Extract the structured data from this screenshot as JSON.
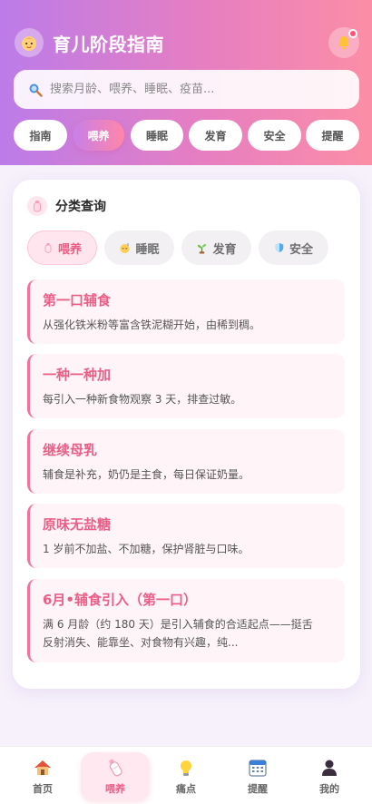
{
  "header": {
    "title": "育儿阶段指南",
    "avatar_icon": "baby-face-icon",
    "bell_icon": "bell-icon"
  },
  "search": {
    "placeholder": "搜索月龄、喂养、睡眠、疫苗..."
  },
  "tabs": [
    {
      "label": "指南",
      "active": false
    },
    {
      "label": "喂养",
      "active": true
    },
    {
      "label": "睡眠",
      "active": false
    },
    {
      "label": "发育",
      "active": false
    },
    {
      "label": "安全",
      "active": false
    },
    {
      "label": "提醒",
      "active": false
    }
  ],
  "category": {
    "title": "分类查询",
    "chips": [
      {
        "label": "喂养",
        "icon": "bottle-icon",
        "active": true
      },
      {
        "label": "睡眠",
        "icon": "sleep-face-icon",
        "active": false
      },
      {
        "label": "发育",
        "icon": "sprout-icon",
        "active": false
      },
      {
        "label": "安全",
        "icon": "shield-icon",
        "active": false
      }
    ]
  },
  "items": [
    {
      "title": "第一口辅食",
      "desc": "从强化铁米粉等富含铁泥糊开始，由稀到稠。"
    },
    {
      "title": "一种一种加",
      "desc": "每引入一种新食物观察 3 天，排查过敏。"
    },
    {
      "title": "继续母乳",
      "desc": "辅食是补充，奶仍是主食，每日保证奶量。"
    },
    {
      "title": "原味无盐糖",
      "desc": "1 岁前不加盐、不加糖，保护肾脏与口味。"
    },
    {
      "title": "6月•辅食引入（第一口）",
      "desc_line1": "满 6 月龄（约 180 天）是引入辅食的合适起点——挺舌",
      "desc_line2": "反射消失、能靠坐、对食物有兴趣，纯..."
    }
  ],
  "bottom_nav": [
    {
      "label": "首页",
      "icon": "house-icon",
      "active": false
    },
    {
      "label": "喂养",
      "icon": "bottle-icon",
      "active": true
    },
    {
      "label": "痛点",
      "icon": "lightbulb-icon",
      "active": false
    },
    {
      "label": "提醒",
      "icon": "calendar-icon",
      "active": false
    },
    {
      "label": "我的",
      "icon": "person-icon",
      "active": false
    }
  ],
  "colors": {
    "accent": "#ef5b87",
    "header_start": "#bb7ce9",
    "header_end": "#fb8ea6"
  }
}
